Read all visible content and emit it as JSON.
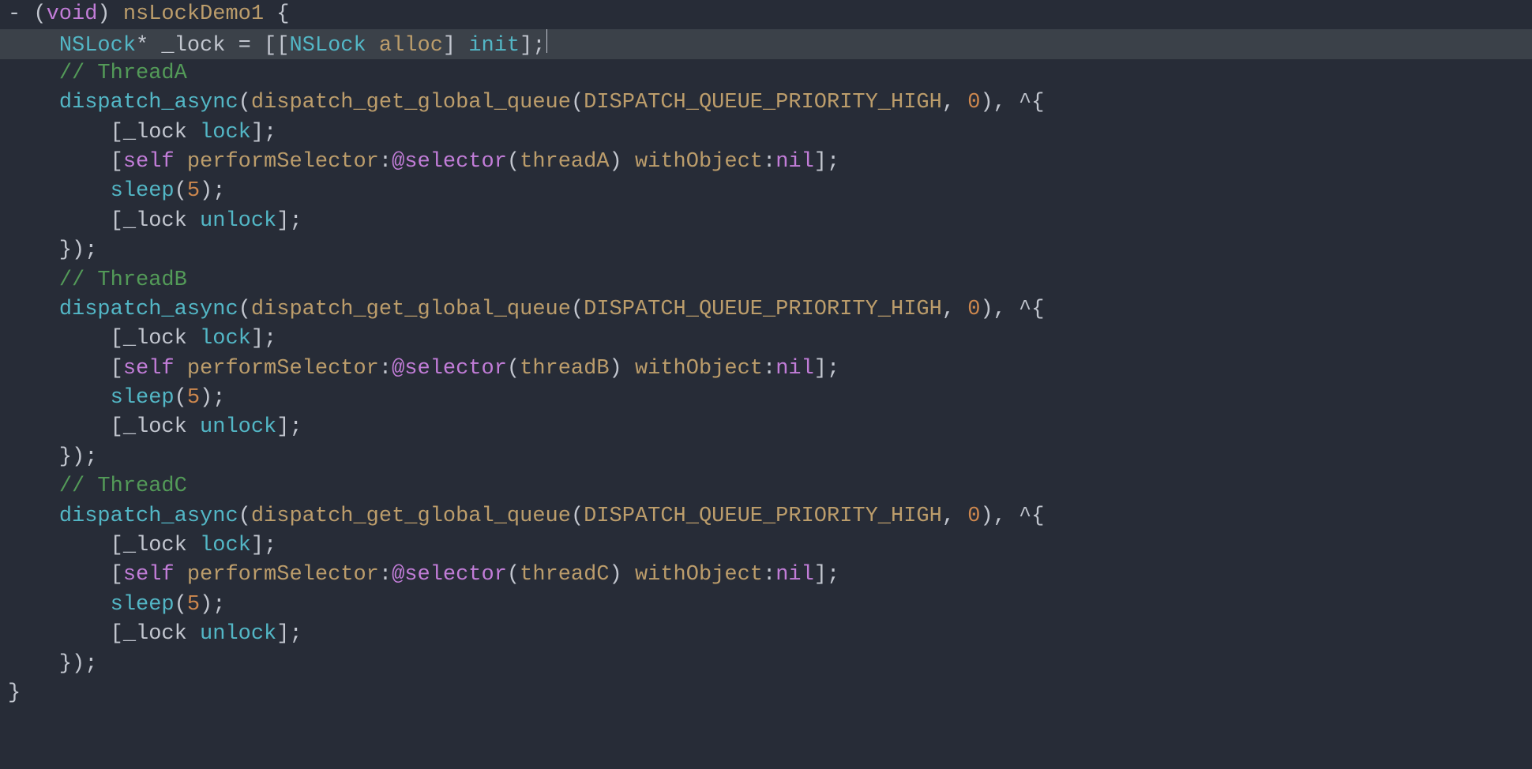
{
  "lines": [
    [
      {
        "cls": "tok-fg",
        "txt": "- "
      },
      {
        "cls": "tok-fg",
        "txt": "("
      },
      {
        "cls": "tok-kw",
        "txt": "void"
      },
      {
        "cls": "tok-fg",
        "txt": ") "
      },
      {
        "cls": "tok-method",
        "txt": "nsLockDemo1"
      },
      {
        "cls": "tok-fg",
        "txt": " {"
      }
    ],
    [
      {
        "cls": "tok-fg",
        "txt": "    "
      },
      {
        "cls": "tok-type",
        "txt": "NSLock"
      },
      {
        "cls": "tok-fg",
        "txt": "* _lock = [["
      },
      {
        "cls": "tok-type",
        "txt": "NSLock"
      },
      {
        "cls": "tok-fg",
        "txt": " "
      },
      {
        "cls": "tok-method",
        "txt": "alloc"
      },
      {
        "cls": "tok-fg",
        "txt": "] "
      },
      {
        "cls": "tok-type",
        "txt": "init"
      },
      {
        "cls": "tok-fg",
        "txt": "];"
      },
      {
        "cls": "cursor",
        "txt": ""
      }
    ],
    [
      {
        "cls": "tok-fg",
        "txt": "    "
      },
      {
        "cls": "tok-comment",
        "txt": "// ThreadA"
      }
    ],
    [
      {
        "cls": "tok-fg",
        "txt": "    "
      },
      {
        "cls": "tok-type",
        "txt": "dispatch_async"
      },
      {
        "cls": "tok-fg",
        "txt": "("
      },
      {
        "cls": "tok-method",
        "txt": "dispatch_get_global_queue"
      },
      {
        "cls": "tok-fg",
        "txt": "("
      },
      {
        "cls": "tok-method",
        "txt": "DISPATCH_QUEUE_PRIORITY_HIGH"
      },
      {
        "cls": "tok-fg",
        "txt": ", "
      },
      {
        "cls": "tok-num",
        "txt": "0"
      },
      {
        "cls": "tok-fg",
        "txt": "), ^{"
      }
    ],
    [
      {
        "cls": "tok-fg",
        "txt": "        [_lock "
      },
      {
        "cls": "tok-type",
        "txt": "lock"
      },
      {
        "cls": "tok-fg",
        "txt": "];"
      }
    ],
    [
      {
        "cls": "tok-fg",
        "txt": "        ["
      },
      {
        "cls": "tok-kw",
        "txt": "self"
      },
      {
        "cls": "tok-fg",
        "txt": " "
      },
      {
        "cls": "tok-method",
        "txt": "performSelector"
      },
      {
        "cls": "tok-fg",
        "txt": ":"
      },
      {
        "cls": "tok-kw",
        "txt": "@selector"
      },
      {
        "cls": "tok-fg",
        "txt": "("
      },
      {
        "cls": "tok-method",
        "txt": "threadA"
      },
      {
        "cls": "tok-fg",
        "txt": ") "
      },
      {
        "cls": "tok-method",
        "txt": "withObject"
      },
      {
        "cls": "tok-fg",
        "txt": ":"
      },
      {
        "cls": "tok-kw",
        "txt": "nil"
      },
      {
        "cls": "tok-fg",
        "txt": "];"
      }
    ],
    [
      {
        "cls": "tok-fg",
        "txt": "        "
      },
      {
        "cls": "tok-type",
        "txt": "sleep"
      },
      {
        "cls": "tok-fg",
        "txt": "("
      },
      {
        "cls": "tok-num",
        "txt": "5"
      },
      {
        "cls": "tok-fg",
        "txt": ");"
      }
    ],
    [
      {
        "cls": "tok-fg",
        "txt": "        [_lock "
      },
      {
        "cls": "tok-type",
        "txt": "unlock"
      },
      {
        "cls": "tok-fg",
        "txt": "];"
      }
    ],
    [
      {
        "cls": "tok-fg",
        "txt": "    });"
      }
    ],
    [
      {
        "cls": "tok-fg",
        "txt": "    "
      },
      {
        "cls": "tok-comment",
        "txt": "// ThreadB"
      }
    ],
    [
      {
        "cls": "tok-fg",
        "txt": "    "
      },
      {
        "cls": "tok-type",
        "txt": "dispatch_async"
      },
      {
        "cls": "tok-fg",
        "txt": "("
      },
      {
        "cls": "tok-method",
        "txt": "dispatch_get_global_queue"
      },
      {
        "cls": "tok-fg",
        "txt": "("
      },
      {
        "cls": "tok-method",
        "txt": "DISPATCH_QUEUE_PRIORITY_HIGH"
      },
      {
        "cls": "tok-fg",
        "txt": ", "
      },
      {
        "cls": "tok-num",
        "txt": "0"
      },
      {
        "cls": "tok-fg",
        "txt": "), ^{"
      }
    ],
    [
      {
        "cls": "tok-fg",
        "txt": "        [_lock "
      },
      {
        "cls": "tok-type",
        "txt": "lock"
      },
      {
        "cls": "tok-fg",
        "txt": "];"
      }
    ],
    [
      {
        "cls": "tok-fg",
        "txt": "        ["
      },
      {
        "cls": "tok-kw",
        "txt": "self"
      },
      {
        "cls": "tok-fg",
        "txt": " "
      },
      {
        "cls": "tok-method",
        "txt": "performSelector"
      },
      {
        "cls": "tok-fg",
        "txt": ":"
      },
      {
        "cls": "tok-kw",
        "txt": "@selector"
      },
      {
        "cls": "tok-fg",
        "txt": "("
      },
      {
        "cls": "tok-method",
        "txt": "threadB"
      },
      {
        "cls": "tok-fg",
        "txt": ") "
      },
      {
        "cls": "tok-method",
        "txt": "withObject"
      },
      {
        "cls": "tok-fg",
        "txt": ":"
      },
      {
        "cls": "tok-kw",
        "txt": "nil"
      },
      {
        "cls": "tok-fg",
        "txt": "];"
      }
    ],
    [
      {
        "cls": "tok-fg",
        "txt": "        "
      },
      {
        "cls": "tok-type",
        "txt": "sleep"
      },
      {
        "cls": "tok-fg",
        "txt": "("
      },
      {
        "cls": "tok-num",
        "txt": "5"
      },
      {
        "cls": "tok-fg",
        "txt": ");"
      }
    ],
    [
      {
        "cls": "tok-fg",
        "txt": "        [_lock "
      },
      {
        "cls": "tok-type",
        "txt": "unlock"
      },
      {
        "cls": "tok-fg",
        "txt": "];"
      }
    ],
    [
      {
        "cls": "tok-fg",
        "txt": "    });"
      }
    ],
    [
      {
        "cls": "tok-fg",
        "txt": "    "
      },
      {
        "cls": "tok-comment",
        "txt": "// ThreadC"
      }
    ],
    [
      {
        "cls": "tok-fg",
        "txt": "    "
      },
      {
        "cls": "tok-type",
        "txt": "dispatch_async"
      },
      {
        "cls": "tok-fg",
        "txt": "("
      },
      {
        "cls": "tok-method",
        "txt": "dispatch_get_global_queue"
      },
      {
        "cls": "tok-fg",
        "txt": "("
      },
      {
        "cls": "tok-method",
        "txt": "DISPATCH_QUEUE_PRIORITY_HIGH"
      },
      {
        "cls": "tok-fg",
        "txt": ", "
      },
      {
        "cls": "tok-num",
        "txt": "0"
      },
      {
        "cls": "tok-fg",
        "txt": "), ^{"
      }
    ],
    [
      {
        "cls": "tok-fg",
        "txt": "        [_lock "
      },
      {
        "cls": "tok-type",
        "txt": "lock"
      },
      {
        "cls": "tok-fg",
        "txt": "];"
      }
    ],
    [
      {
        "cls": "tok-fg",
        "txt": "        ["
      },
      {
        "cls": "tok-kw",
        "txt": "self"
      },
      {
        "cls": "tok-fg",
        "txt": " "
      },
      {
        "cls": "tok-method",
        "txt": "performSelector"
      },
      {
        "cls": "tok-fg",
        "txt": ":"
      },
      {
        "cls": "tok-kw",
        "txt": "@selector"
      },
      {
        "cls": "tok-fg",
        "txt": "("
      },
      {
        "cls": "tok-method",
        "txt": "threadC"
      },
      {
        "cls": "tok-fg",
        "txt": ") "
      },
      {
        "cls": "tok-method",
        "txt": "withObject"
      },
      {
        "cls": "tok-fg",
        "txt": ":"
      },
      {
        "cls": "tok-kw",
        "txt": "nil"
      },
      {
        "cls": "tok-fg",
        "txt": "];"
      }
    ],
    [
      {
        "cls": "tok-fg",
        "txt": "        "
      },
      {
        "cls": "tok-type",
        "txt": "sleep"
      },
      {
        "cls": "tok-fg",
        "txt": "("
      },
      {
        "cls": "tok-num",
        "txt": "5"
      },
      {
        "cls": "tok-fg",
        "txt": ");"
      }
    ],
    [
      {
        "cls": "tok-fg",
        "txt": "        [_lock "
      },
      {
        "cls": "tok-type",
        "txt": "unlock"
      },
      {
        "cls": "tok-fg",
        "txt": "];"
      }
    ],
    [
      {
        "cls": "tok-fg",
        "txt": "    });"
      }
    ],
    [
      {
        "cls": "tok-fg",
        "txt": "}"
      }
    ]
  ],
  "highlighted_line_index": 1
}
